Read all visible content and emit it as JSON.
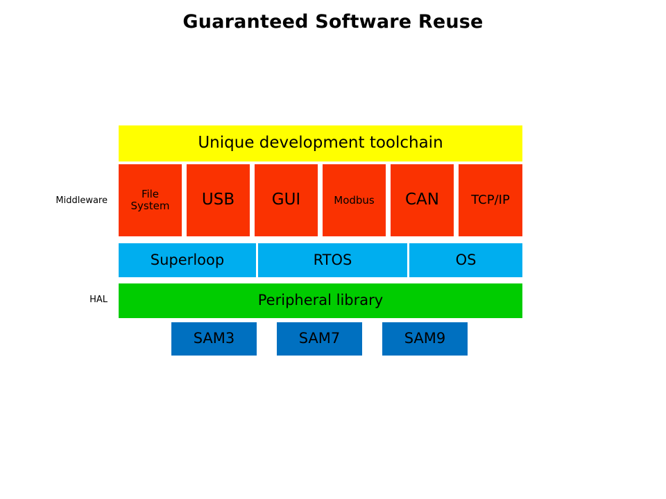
{
  "slide": {
    "title": "Guaranteed Software Reuse",
    "background": "#FFFFFF"
  },
  "colors": {
    "toolchain": "#FFFF00",
    "middleware": "#FA3201",
    "os": "#00AEEF",
    "hal": "#00CC00",
    "device": "#0070C0",
    "text": "#000000"
  },
  "side_labels": {
    "middleware": "Middleware",
    "hal": "HAL"
  },
  "layers": {
    "toolchain": {
      "label": "Unique development toolchain"
    },
    "middleware": {
      "items": [
        {
          "label": "File\nSystem",
          "size": "small"
        },
        {
          "label": "USB",
          "size": "large"
        },
        {
          "label": "GUI",
          "size": "large"
        },
        {
          "label": "Modbus",
          "size": "small"
        },
        {
          "label": "CAN",
          "size": "large"
        },
        {
          "label": "TCP/IP",
          "size": "med"
        }
      ]
    },
    "os": {
      "items": [
        {
          "label": "Superloop"
        },
        {
          "label": "RTOS"
        },
        {
          "label": "OS"
        }
      ]
    },
    "hal": {
      "label": "Peripheral library"
    },
    "devices": {
      "items": [
        {
          "label": "SAM3"
        },
        {
          "label": "SAM7"
        },
        {
          "label": "SAM9"
        }
      ]
    }
  }
}
